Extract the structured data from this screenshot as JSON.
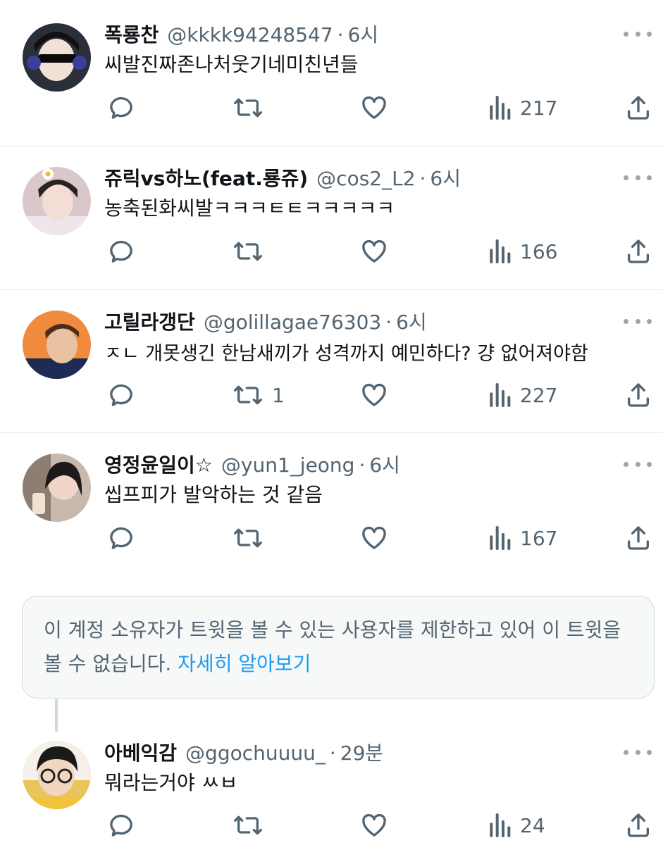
{
  "tweets": [
    {
      "name": "폭룡찬",
      "handle": "@kkkk94248547",
      "time": "6시",
      "text": "씨발진짜존나처웃기네미친년들",
      "reply_count": "",
      "retweet_count": "",
      "like_count": "",
      "view_count": "217",
      "avatar_bg": "#2b2f3a"
    },
    {
      "name": "쥬릭vs하노(feat.룡쥬)",
      "handle": "@cos2_L2",
      "time": "6시",
      "text": "농축된화씨발ㅋㅋㅋㅌㅌㅋㅋㅋㅋㅋ",
      "reply_count": "",
      "retweet_count": "",
      "like_count": "",
      "view_count": "166",
      "avatar_bg": "#d9c7c9"
    },
    {
      "name": "고릴라갱단",
      "handle": "@golillagae76303",
      "time": "6시",
      "text": "ㅈㄴ 개못생긴 한남새끼가 성격까지 예민하다? 걍 없어져야함",
      "reply_count": "",
      "retweet_count": "1",
      "like_count": "",
      "view_count": "227",
      "avatar_bg": "#f08a3c"
    },
    {
      "name": "영정윤일이☆",
      "handle": "@yun1_jeong",
      "time": "6시",
      "text": "씹프피가 발악하는 것 같음",
      "reply_count": "",
      "retweet_count": "",
      "like_count": "",
      "view_count": "167",
      "avatar_bg": "#c9b9ad"
    },
    {
      "name": "아베익감",
      "handle": "@ggochuuuu_",
      "time": "29분",
      "text": "뭐라는거야 ㅆㅂ",
      "reply_count": "",
      "retweet_count": "",
      "like_count": "",
      "view_count": "24",
      "avatar_bg": "#e8c45a"
    }
  ],
  "separator": "·",
  "notice": {
    "text": "이 계정 소유자가 트윗을 볼 수 있는 사용자를 제한하고 있어 이 트윗을 볼 수 없습니다.",
    "link": "자세히 알아보기"
  },
  "icons": {
    "reply": "reply-icon",
    "retweet": "retweet-icon",
    "like": "like-icon",
    "views": "views-icon",
    "share": "share-icon",
    "more": "more-icon"
  },
  "colors": {
    "text": "#0f1419",
    "secondary": "#536471",
    "link": "#1d9bf0",
    "divider": "#e6e9ec"
  }
}
